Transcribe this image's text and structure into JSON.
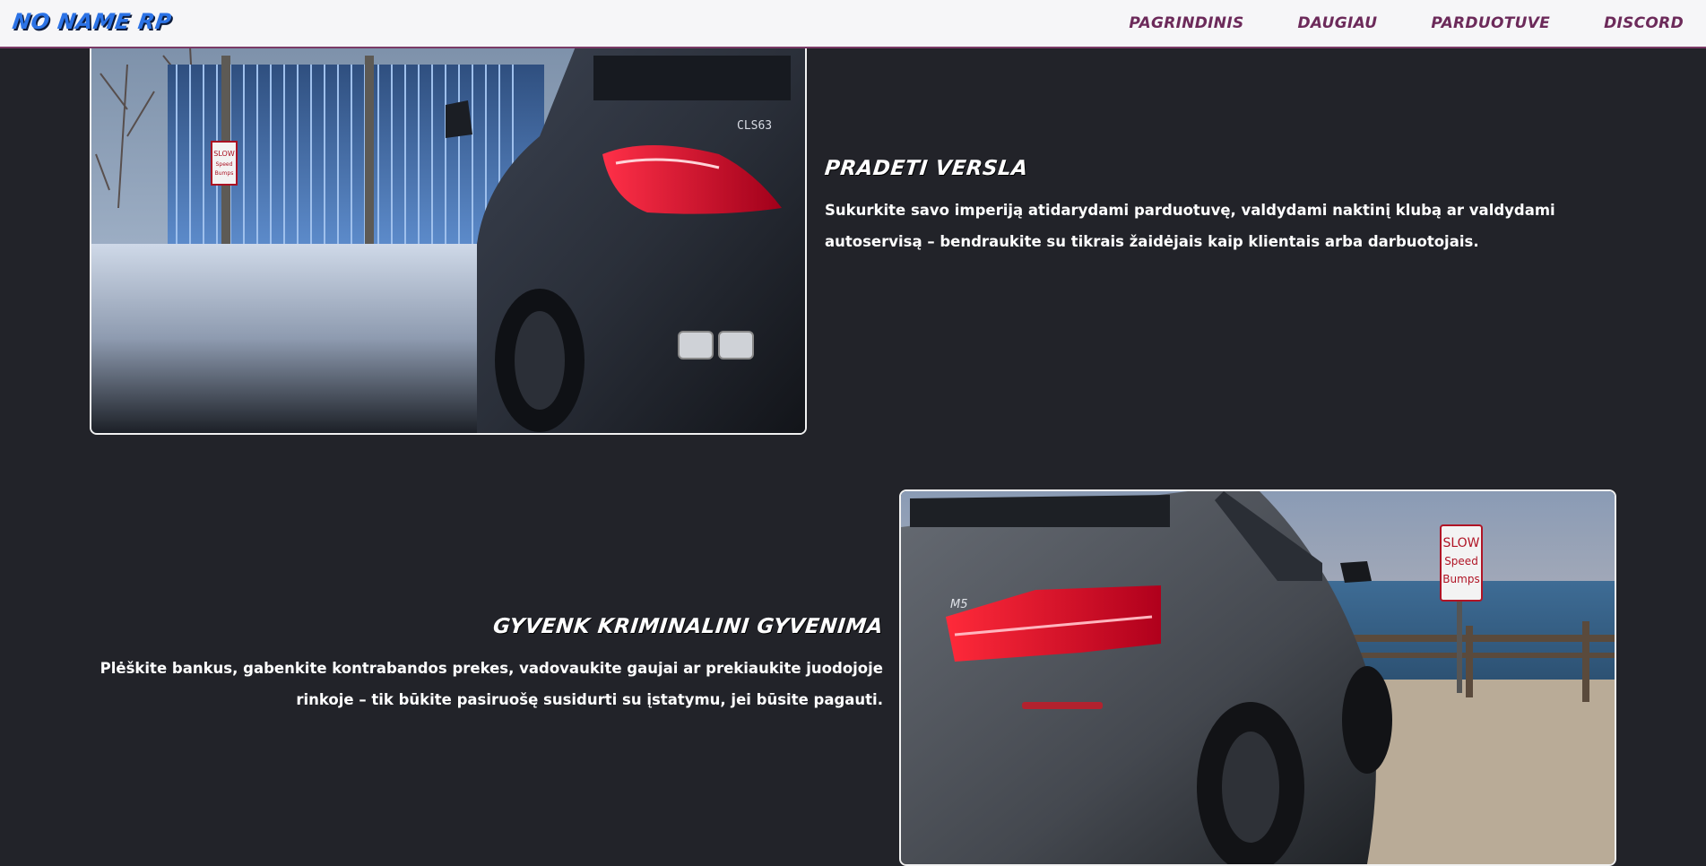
{
  "navbar": {
    "brand": "NO NAME RP",
    "links": [
      "PAGRINDINIS",
      "DAUGIAU",
      "PARDUOTUVE",
      "DISCORD"
    ]
  },
  "sections": [
    {
      "title": "PRADETI VERSLA",
      "body": "Sukurkite savo imperiją atidarydami parduotuvę, valdydami naktinį klubą ar valdydami autoservisą – bendraukite su tikrais žaidėjais kaip klientais arba darbuotojais.",
      "image": {
        "sign_lines": [
          "SLOW",
          "Speed",
          "Bumps"
        ],
        "badge": "CLS63"
      }
    },
    {
      "title": "GYVENK KRIMINALINI GYVENIMA",
      "body": "Plėškite bankus, gabenkite kontrabandos prekes, vadovaukite gaujai ar prekiaukite juodojoje rinkoje – tik būkite pasiruošę susidurti su įstatymu, jei būsite pagauti.",
      "image": {
        "sign_lines": [
          "SLOW",
          "Speed",
          "Bumps"
        ],
        "badge": "M5"
      }
    }
  ],
  "colors": {
    "background": "#222329",
    "navbar_bg": "#f6f6f8",
    "brand": "#2c73e6",
    "nav_link": "#6c2a5a",
    "text": "#ffffff"
  }
}
